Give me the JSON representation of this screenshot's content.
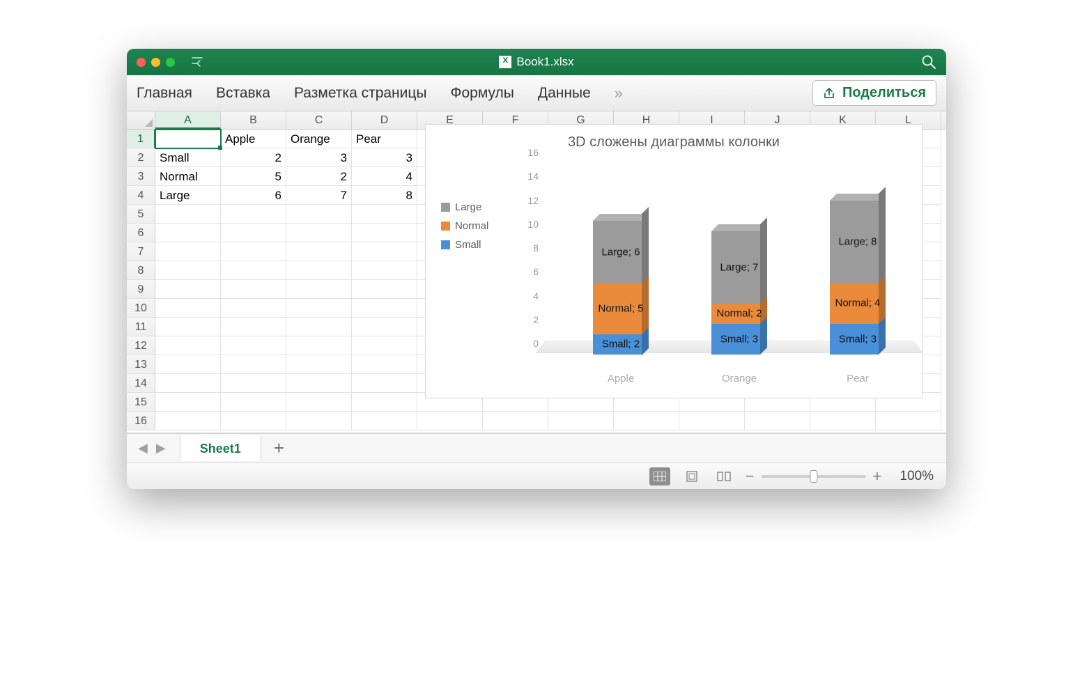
{
  "window": {
    "title": "Book1.xlsx"
  },
  "ribbon": {
    "tabs": [
      "Главная",
      "Вставка",
      "Разметка страницы",
      "Формулы",
      "Данные"
    ],
    "more": "»",
    "share": "Поделиться"
  },
  "columns": [
    "A",
    "B",
    "C",
    "D",
    "E",
    "F",
    "G",
    "H",
    "I",
    "J",
    "K",
    "L"
  ],
  "rows_visible": 16,
  "active_cell": "A1",
  "table": {
    "headers": [
      "",
      "Apple",
      "Orange",
      "Pear"
    ],
    "rows": [
      [
        "Small",
        "2",
        "3",
        "3"
      ],
      [
        "Normal",
        "5",
        "2",
        "4"
      ],
      [
        "Large",
        "6",
        "7",
        "8"
      ]
    ]
  },
  "chart": {
    "title": "3D сложены диаграммы колонки",
    "legend": [
      "Large",
      "Normal",
      "Small"
    ]
  },
  "chart_data": {
    "type": "bar",
    "stacked": true,
    "categories": [
      "Apple",
      "Orange",
      "Pear"
    ],
    "series": [
      {
        "name": "Small",
        "values": [
          2,
          3,
          3
        ],
        "color": "#4a90d9"
      },
      {
        "name": "Normal",
        "values": [
          5,
          2,
          4
        ],
        "color": "#e98b3a"
      },
      {
        "name": "Large",
        "values": [
          6,
          7,
          8
        ],
        "color": "#9b9b9b"
      }
    ],
    "ylim": [
      0,
      16
    ],
    "ytick_step": 2,
    "title": "3D сложены диаграммы колонки",
    "xlabel": "",
    "ylabel": ""
  },
  "sheet": {
    "name": "Sheet1"
  },
  "status": {
    "zoom": "100%"
  }
}
